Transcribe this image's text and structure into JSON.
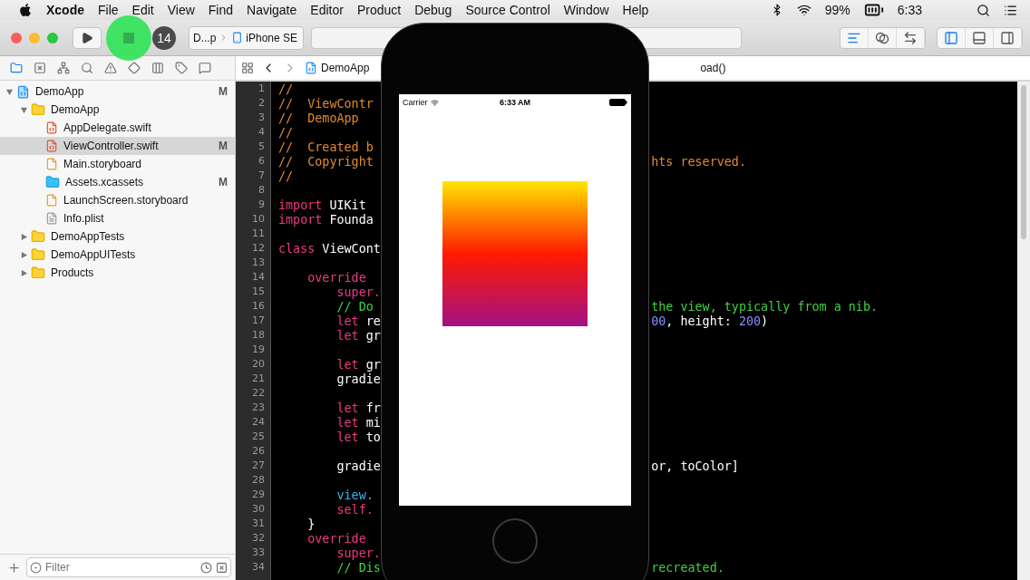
{
  "menu_bar": {
    "app": "Xcode",
    "menus": [
      "File",
      "Edit",
      "View",
      "Find",
      "Navigate",
      "Editor",
      "Product",
      "Debug",
      "Source Control",
      "Window",
      "Help"
    ],
    "battery": "99%",
    "time": "6:33"
  },
  "toolbar": {
    "scheme": "D...p",
    "device": "iPhone SE",
    "click_count": "14",
    "editor_modes": [
      {
        "kind": "standard",
        "selected": true
      },
      {
        "kind": "assistant",
        "selected": false
      },
      {
        "kind": "version",
        "selected": false
      }
    ],
    "panels": [
      {
        "kind": "left",
        "selected": true
      },
      {
        "kind": "bottom",
        "selected": false
      },
      {
        "kind": "right",
        "selected": false
      }
    ]
  },
  "navigator": {
    "tabs": [
      {
        "kind": "project",
        "selected": true
      },
      {
        "kind": "source",
        "selected": false
      },
      {
        "kind": "symbol",
        "selected": false
      },
      {
        "kind": "find",
        "selected": false
      },
      {
        "kind": "issue",
        "selected": false
      },
      {
        "kind": "test",
        "selected": false
      },
      {
        "kind": "debug",
        "selected": false
      },
      {
        "kind": "breakpoint",
        "selected": false
      },
      {
        "kind": "report",
        "selected": false
      }
    ],
    "tree": [
      {
        "name": "DemoApp",
        "kind": "project",
        "status": "M",
        "selected": false,
        "expanded": true,
        "children": [
          {
            "name": "DemoApp",
            "kind": "folder",
            "selected": false,
            "expanded": true,
            "children": [
              {
                "name": "AppDelegate.swift",
                "kind": "swift",
                "selected": false
              },
              {
                "name": "ViewController.swift",
                "kind": "swift",
                "status": "M",
                "selected": true
              },
              {
                "name": "Main.storyboard",
                "kind": "storyboard",
                "selected": false
              },
              {
                "name": "Assets.xcassets",
                "kind": "assets",
                "status": "M",
                "selected": false
              },
              {
                "name": "LaunchScreen.storyboard",
                "kind": "storyboard",
                "selected": false
              },
              {
                "name": "Info.plist",
                "kind": "plist",
                "selected": false
              }
            ]
          },
          {
            "name": "DemoAppTests",
            "kind": "folder",
            "selected": false,
            "expanded": false
          },
          {
            "name": "DemoAppUITests",
            "kind": "folder",
            "selected": false,
            "expanded": false
          },
          {
            "name": "Products",
            "kind": "folder",
            "selected": false,
            "expanded": false
          }
        ]
      }
    ],
    "filter": {
      "placeholder": "Filter"
    }
  },
  "editor": {
    "jump_bar": {
      "file": "DemoApp",
      "tail": "oad()"
    },
    "lines": [
      {
        "number": "1",
        "left": [
          {
            "kind": "comment",
            "t": "//"
          }
        ]
      },
      {
        "number": "2",
        "left": [
          {
            "kind": "comment",
            "t": "//  ViewContr"
          }
        ]
      },
      {
        "number": "3",
        "left": [
          {
            "kind": "comment",
            "t": "//  DemoApp"
          }
        ]
      },
      {
        "number": "4",
        "left": [
          {
            "kind": "comment",
            "t": "//"
          }
        ]
      },
      {
        "number": "5",
        "left": [
          {
            "kind": "comment",
            "t": "//  Created b"
          }
        ]
      },
      {
        "number": "6",
        "left": [
          {
            "kind": "comment",
            "t": "//  Copyright"
          }
        ],
        "right": [
          {
            "kind": "comment",
            "t": "hts reserved."
          }
        ]
      },
      {
        "number": "7",
        "left": [
          {
            "kind": "comment",
            "t": "//"
          }
        ]
      },
      {
        "number": "8"
      },
      {
        "number": "9",
        "left": [
          {
            "kind": "keyword",
            "t": "import"
          },
          {
            "kind": "plain",
            "t": " UIKit"
          }
        ]
      },
      {
        "number": "10",
        "left": [
          {
            "kind": "keyword",
            "t": "import"
          },
          {
            "kind": "plain",
            "t": " Founda"
          }
        ]
      },
      {
        "number": "11"
      },
      {
        "number": "12",
        "left": [
          {
            "kind": "keyword",
            "t": "class"
          },
          {
            "kind": "plain",
            "t": " ViewCont"
          }
        ]
      },
      {
        "number": "13"
      },
      {
        "number": "14",
        "left": [
          {
            "kind": "keyword",
            "t": "    override"
          }
        ]
      },
      {
        "number": "15",
        "left": [
          {
            "kind": "keyword",
            "t": "        super."
          }
        ]
      },
      {
        "number": "16",
        "left": [
          {
            "kind": "doc",
            "t": "        // Do"
          }
        ],
        "right": [
          {
            "kind": "doc",
            "t": "the view, typically from a nib."
          }
        ]
      },
      {
        "number": "17",
        "left": [
          {
            "kind": "keyword",
            "t": "        let"
          },
          {
            "kind": "plain",
            "t": " re"
          }
        ],
        "right": [
          {
            "kind": "number",
            "t": "00"
          },
          {
            "kind": "plain",
            "t": ", height: "
          },
          {
            "kind": "number",
            "t": "200"
          },
          {
            "kind": "plain",
            "t": ")"
          }
        ]
      },
      {
        "number": "18",
        "left": [
          {
            "kind": "keyword",
            "t": "        let"
          },
          {
            "kind": "plain",
            "t": " gr"
          }
        ]
      },
      {
        "number": "19"
      },
      {
        "number": "20",
        "left": [
          {
            "kind": "keyword",
            "t": "        let"
          },
          {
            "kind": "plain",
            "t": " gr"
          }
        ]
      },
      {
        "number": "21",
        "left": [
          {
            "kind": "plain",
            "t": "        gradie"
          }
        ]
      },
      {
        "number": "22"
      },
      {
        "number": "23",
        "left": [
          {
            "kind": "keyword",
            "t": "        let"
          },
          {
            "kind": "plain",
            "t": " fr"
          }
        ]
      },
      {
        "number": "24",
        "left": [
          {
            "kind": "keyword",
            "t": "        let"
          },
          {
            "kind": "plain",
            "t": " mi"
          }
        ]
      },
      {
        "number": "25",
        "left": [
          {
            "kind": "keyword",
            "t": "        let"
          },
          {
            "kind": "plain",
            "t": " to"
          }
        ]
      },
      {
        "number": "26"
      },
      {
        "number": "27",
        "left": [
          {
            "kind": "plain",
            "t": "        gradie"
          }
        ],
        "right": [
          {
            "kind": "plain",
            "t": "or, toColor]"
          }
        ]
      },
      {
        "number": "28"
      },
      {
        "number": "29",
        "left": [
          {
            "kind": "type",
            "t": "        view."
          }
        ]
      },
      {
        "number": "30",
        "left": [
          {
            "kind": "keyword",
            "t": "        self."
          }
        ]
      },
      {
        "number": "31",
        "left": [
          {
            "kind": "plain",
            "t": "    }"
          }
        ]
      },
      {
        "number": "32",
        "left": [
          {
            "kind": "keyword",
            "t": "    override"
          }
        ]
      },
      {
        "number": "33",
        "left": [
          {
            "kind": "keyword",
            "t": "        super."
          }
        ]
      },
      {
        "number": "34",
        "left": [
          {
            "kind": "doc",
            "t": "        // Dis"
          }
        ],
        "right": [
          {
            "kind": "doc",
            "t": "recreated."
          }
        ]
      }
    ]
  },
  "simulator": {
    "carrier": "Carrier",
    "time": "6:33 AM"
  }
}
